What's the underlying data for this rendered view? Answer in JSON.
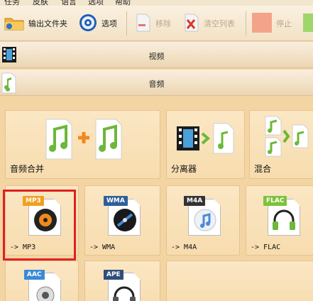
{
  "menu": {
    "items": [
      "任务",
      "皮肤",
      "语言",
      "选项",
      "帮助"
    ]
  },
  "toolbar": {
    "output_folder": "输出文件夹",
    "options": "选项",
    "remove": "移除",
    "clear_list": "清空列表",
    "stop": "停止"
  },
  "sections": {
    "video": "视频",
    "audio": "音频"
  },
  "tiles": {
    "audio_merge": "音频合并",
    "separator": "分离器",
    "mix": "混合",
    "to_mp3": "-> MP3",
    "to_wma": "-> WMA",
    "to_m4a": "-> M4A",
    "to_flac": "-> FLAC"
  },
  "formats": {
    "mp3": "MP3",
    "wma": "WMA",
    "m4a": "M4A",
    "flac": "FLAC",
    "aac": "AAC",
    "ape": "APE"
  },
  "colors": {
    "background": "#f3d5a3",
    "tile": "#f7dcae",
    "highlight": "#e0201e",
    "music_green": "#8cc63e"
  }
}
